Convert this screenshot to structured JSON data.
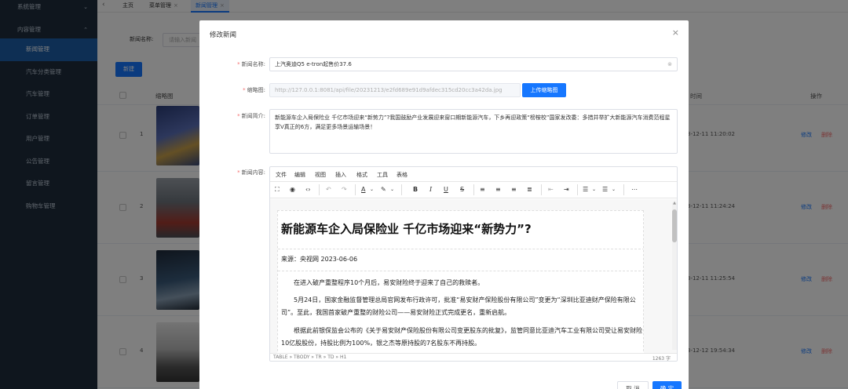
{
  "sidebar": {
    "groups": [
      {
        "label": "系统管理"
      },
      {
        "label": "内容管理"
      }
    ],
    "items": [
      {
        "label": "新闻管理",
        "active": true
      },
      {
        "label": "汽车分类管理"
      },
      {
        "label": "汽车管理"
      },
      {
        "label": "订单管理"
      },
      {
        "label": "用户管理"
      },
      {
        "label": "公告管理"
      },
      {
        "label": "留言管理"
      },
      {
        "label": "购物车管理"
      }
    ]
  },
  "tabs": [
    {
      "label": "主页"
    },
    {
      "label": "菜单管理",
      "close": "×"
    },
    {
      "label": "新闻管理",
      "close": "×"
    }
  ],
  "filter": {
    "label": "新闻名称:",
    "placeholder": "请输入新闻"
  },
  "new_button": "新建",
  "table": {
    "headers": {
      "thumb": "缩略图",
      "time": "时间",
      "actions": "操作"
    },
    "rows": [
      {
        "index": "1",
        "time": "3-12-11 11:20:02",
        "edit": "修改",
        "delete": "删除"
      },
      {
        "index": "2",
        "time": "3-12-11 11:24:24",
        "edit": "修改",
        "delete": "删除"
      },
      {
        "index": "3",
        "time": "3-12-11 11:25:54",
        "edit": "修改",
        "delete": "删除"
      },
      {
        "index": "4",
        "time": "3-12-12 19:54:34",
        "edit": "修改",
        "delete": "删除"
      }
    ]
  },
  "dialog": {
    "title": "修改新闻",
    "close": "×",
    "name_label": "新闻名称:",
    "name_value": "上汽奥迪Q5 e-tron起售价37.6",
    "thumb_label": "缩略图:",
    "thumb_value": "http://127.0.0.1:8081/api/file/20231213/e2fd689e91d9afdec315cd20cc3a42da.jpg",
    "upload_button": "上传缩略图",
    "intro_label": "新闻简介:",
    "intro_value": "新能源车企入局保险业 千亿市场迎来“新势力”?我国鼓励产业发展迎来窗口期新能源汽车，下乡再迎政策“榜桉校”国家发改委：多措并举扩大新能源汽车消费范程星享V真正的6方，满足更多场景运输场景！",
    "content_label": "新闻内容:",
    "cancel": "取 消",
    "confirm": "确 定"
  },
  "editor": {
    "menus": [
      "文件",
      "编辑",
      "视图",
      "插入",
      "格式",
      "工具",
      "表格"
    ],
    "doc_title": "新能源车企入局保险业 千亿市场迎来“新势力”?",
    "doc_source": "来源：央视网    2023-06-06",
    "paragraphs": [
      "在进入破产重整程序10个月后，易安财险终于迎来了自己的救赎者。",
      "5月24日，国家金融监督管理总局官网发布行政许可，批准“易安财产保险股份有限公司”变更为“深圳比亚迪财产保险有限公司”。至此，我国首家破产重整的财险公司——易安财险正式完成更名，重新启航。",
      "根据此前银保监会公布的《关于易安财产保险股份有限公司变更股东的批复》，监管同意比亚迪汽车工业有限公司受让易安财险10亿股股份，持股比例为100%，银之杰等原持股的7名股东不再持股。"
    ],
    "status_path": "TABLE » TBODY » TR » TD » H1",
    "word_count": "1263 字"
  }
}
